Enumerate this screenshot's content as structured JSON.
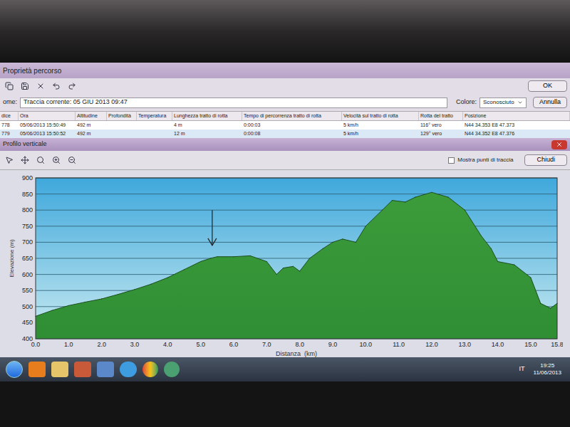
{
  "window": {
    "title": "Proprietà percorso",
    "buttons": [
      "OK",
      "Annulla"
    ]
  },
  "name_field": {
    "label": "ome:",
    "value": "Traccia corrente: 05 GIU 2013 09:47"
  },
  "color_field": {
    "label": "Colore:",
    "value": "Sconosciuto"
  },
  "table": {
    "columns": [
      "dice",
      "Ora",
      "Altitudine",
      "Profondità",
      "Temperatura",
      "Lunghezza tratto di rotta",
      "Tempo di percorrenza tratto di rotta",
      "Velocità sul tratto di rotta",
      "Rotta del tratto",
      "Posizione"
    ],
    "rows": [
      {
        "cells": [
          "778",
          "05/06/2013 15:50:49",
          "492 m",
          "",
          "",
          "4 m",
          "0:00:03",
          "5 km/h",
          "116° vero",
          "N44 34.353 E8 47.373"
        ],
        "selected": false
      },
      {
        "cells": [
          "779",
          "05/06/2013 15:50:52",
          "492 m",
          "",
          "",
          "12 m",
          "0:00:08",
          "5 km/h",
          "129° vero",
          "N44 34.352 E8 47.376"
        ],
        "selected": true
      }
    ]
  },
  "profile_window": {
    "title": "Profilo verticale",
    "checkbox": {
      "label": "Mostra punti di traccia",
      "checked": false
    },
    "button": "Chiudi"
  },
  "chart": {
    "x_label": "Distanza  (km)",
    "y_label": "Elevazione (m)",
    "x_ticks": [
      "0.0",
      "1.0",
      "2.0",
      "3.0",
      "4.0",
      "5.0",
      "6.0",
      "7.0",
      "8.0",
      "9.0",
      "10.0",
      "11.0",
      "12.0",
      "13.0",
      "14.0",
      "15.0",
      "15.8"
    ],
    "y_ticks": [
      "400",
      "450",
      "500",
      "550",
      "600",
      "650",
      "700",
      "750",
      "800",
      "850",
      "900"
    ],
    "distance_km": [
      0,
      0.5,
      1,
      1.5,
      2,
      2.5,
      3,
      3.5,
      4,
      4.5,
      5,
      5.3,
      5.5,
      6,
      6.5,
      7,
      7.3,
      7.5,
      7.8,
      8,
      8.3,
      8.7,
      9,
      9.3,
      9.7,
      10,
      10.5,
      10.8,
      11.2,
      11.5,
      12,
      12.5,
      13,
      13.5,
      13.8,
      14,
      14.5,
      15,
      15.3,
      15.6,
      15.8
    ],
    "elevation_m": [
      470,
      488,
      503,
      514,
      524,
      538,
      553,
      570,
      590,
      615,
      640,
      650,
      655,
      655,
      658,
      640,
      600,
      620,
      625,
      610,
      650,
      680,
      700,
      710,
      700,
      750,
      800,
      830,
      825,
      840,
      855,
      840,
      800,
      720,
      680,
      640,
      630,
      590,
      510,
      495,
      510
    ],
    "arrow": {
      "distance_km": 5.35,
      "from_m": 800,
      "to_m": 690
    }
  },
  "taskbar": {
    "language": "IT",
    "time": "19:25",
    "date": "11/06/2013"
  }
}
